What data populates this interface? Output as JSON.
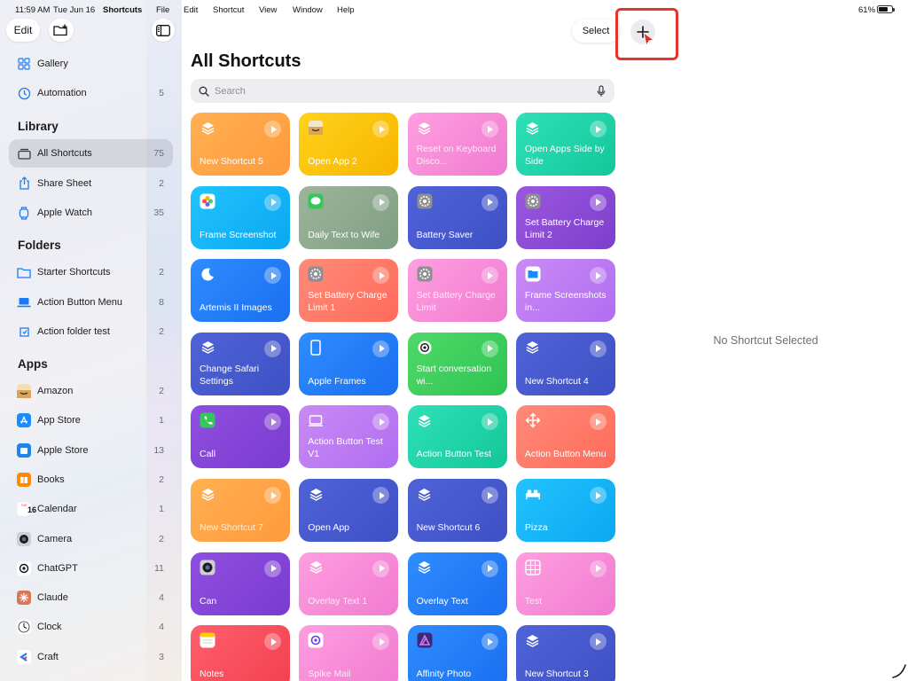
{
  "menubar": {
    "time": "11:59 AM",
    "date": "Tue Jun 16",
    "app_name": "Shortcuts",
    "menus": [
      "File",
      "Edit",
      "Shortcut",
      "View",
      "Window",
      "Help"
    ],
    "battery_text": "61%",
    "battery_level": 0.61
  },
  "sidebar": {
    "edit_label": "Edit",
    "top_items": [
      {
        "label": "Gallery",
        "count": "",
        "icon": "grid-icon"
      },
      {
        "label": "Automation",
        "count": "5",
        "icon": "clock-check-icon"
      }
    ],
    "library_heading": "Library",
    "library_items": [
      {
        "label": "All Shortcuts",
        "count": "75",
        "icon": "stack-icon",
        "selected": true
      },
      {
        "label": "Share Sheet",
        "count": "2",
        "icon": "share-icon"
      },
      {
        "label": "Apple Watch",
        "count": "35",
        "icon": "watch-icon"
      }
    ],
    "folders_heading": "Folders",
    "folder_items": [
      {
        "label": "Starter Shortcuts",
        "count": "2",
        "icon": "folder-icon"
      },
      {
        "label": "Action Button Menu",
        "count": "8",
        "icon": "laptop-icon"
      },
      {
        "label": "Action folder test",
        "count": "2",
        "icon": "action-icon"
      }
    ],
    "apps_heading": "Apps",
    "app_items": [
      {
        "label": "Amazon",
        "count": "2",
        "color": "#f3a847"
      },
      {
        "label": "App Store",
        "count": "1",
        "color": "#1a8cff"
      },
      {
        "label": "Apple Store",
        "count": "13",
        "color": "#1f84e8"
      },
      {
        "label": "Books",
        "count": "2",
        "color": "#ff8a00"
      },
      {
        "label": "Calendar",
        "count": "1",
        "color": "#ffffff"
      },
      {
        "label": "Camera",
        "count": "2",
        "color": "#3a3a3c"
      },
      {
        "label": "ChatGPT",
        "count": "11",
        "color": "#ffffff"
      },
      {
        "label": "Claude",
        "count": "4",
        "color": "#d97757"
      },
      {
        "label": "Clock",
        "count": "4",
        "color": "#ffffff"
      },
      {
        "label": "Craft",
        "count": "3",
        "color": "#ffffff"
      }
    ],
    "calendar_day": "16"
  },
  "main": {
    "title": "All Shortcuts",
    "select_label": "Select",
    "search_placeholder": "Search",
    "tiles": [
      {
        "name": "New Shortcut 5",
        "bg": "linear-gradient(135deg,#ffb052,#ff9a3c)",
        "icon": "layers"
      },
      {
        "name": "Open App 2",
        "bg": "linear-gradient(135deg,#ffd21a,#f7b500)",
        "icon": "amazon"
      },
      {
        "name": "Reset on Keyboard Disco...",
        "bg": "linear-gradient(135deg,#ff9ee0,#f07bd0)",
        "icon": "layers",
        "faded": true
      },
      {
        "name": "Open Apps Side by Side",
        "bg": "linear-gradient(135deg,#2fe0b8,#13c79a)",
        "icon": "layers"
      },
      {
        "name": "Frame Screenshot",
        "bg": "linear-gradient(135deg,#22c3ff,#0aa8f0)",
        "icon": "photos"
      },
      {
        "name": "Daily Text to Wife",
        "bg": "linear-gradient(135deg,#9db59c,#7f9e82)",
        "icon": "messages"
      },
      {
        "name": "Battery Saver",
        "bg": "linear-gradient(135deg,#4f63d8,#3e50c4)",
        "icon": "settings"
      },
      {
        "name": "Set Battery Charge Limit 2",
        "bg": "linear-gradient(135deg,#9b57e0,#7d3fcc)",
        "icon": "settings"
      },
      {
        "name": "Artemis II Images",
        "bg": "linear-gradient(135deg,#2f8cff,#1a6ff0)",
        "icon": "moon"
      },
      {
        "name": "Set Battery Charge Limit 1",
        "bg": "linear-gradient(135deg,#ff8a78,#ff6b5a)",
        "icon": "settings"
      },
      {
        "name": "Set Battery Charge Limit",
        "bg": "linear-gradient(135deg,#ff9ee0,#f07bd0)",
        "icon": "settings",
        "faded": true
      },
      {
        "name": "Frame Screenshots in...",
        "bg": "linear-gradient(135deg,#c98af5,#b06ef0)",
        "icon": "files"
      },
      {
        "name": "Change Safari Settings",
        "bg": "linear-gradient(135deg,#4f63d8,#3e50c4)",
        "icon": "layers"
      },
      {
        "name": "Apple Frames",
        "bg": "linear-gradient(135deg,#2f8cff,#1a6ff0)",
        "icon": "phone-outline"
      },
      {
        "name": "Start conversation wi...",
        "bg": "linear-gradient(135deg,#4fd968,#2fc452)",
        "icon": "chatgpt"
      },
      {
        "name": "New Shortcut 4",
        "bg": "linear-gradient(135deg,#4f63d8,#3e50c4)",
        "icon": "layers"
      },
      {
        "name": "Call",
        "bg": "linear-gradient(135deg,#8f4fe0,#7a3bd0)",
        "icon": "phone"
      },
      {
        "name": "Action Button Test V1",
        "bg": "linear-gradient(135deg,#c98af5,#b06ef0)",
        "icon": "laptop"
      },
      {
        "name": "Action Button Test",
        "bg": "linear-gradient(135deg,#2fe0b8,#13c79a)",
        "icon": "layers"
      },
      {
        "name": "Action Button Menu",
        "bg": "linear-gradient(135deg,#ff8a78,#ff6b5a)",
        "icon": "move"
      },
      {
        "name": "New Shortcut 7",
        "bg": "linear-gradient(135deg,#ffb052,#ff9a3c)",
        "icon": "layers",
        "faded": true
      },
      {
        "name": "Open App",
        "bg": "linear-gradient(135deg,#4f63d8,#3e50c4)",
        "icon": "layers"
      },
      {
        "name": "New Shortcut 6",
        "bg": "linear-gradient(135deg,#4f63d8,#3e50c4)",
        "icon": "layers"
      },
      {
        "name": "Pizza",
        "bg": "linear-gradient(135deg,#22c3ff,#0aa8f0)",
        "icon": "bed"
      },
      {
        "name": "Can",
        "bg": "linear-gradient(135deg,#8f4fe0,#7a3bd0)",
        "icon": "camera"
      },
      {
        "name": "Overlay Text 1",
        "bg": "linear-gradient(135deg,#ff9ee0,#f07bd0)",
        "icon": "layers",
        "faded": true
      },
      {
        "name": "Overlay Text",
        "bg": "linear-gradient(135deg,#2f8cff,#1a6ff0)",
        "icon": "layers"
      },
      {
        "name": "Test",
        "bg": "linear-gradient(135deg,#ff9ee0,#f07bd0)",
        "icon": "grid-dots",
        "faded": true
      },
      {
        "name": "Notes",
        "bg": "linear-gradient(135deg,#ff5f6d,#f2404f)",
        "icon": "notes"
      },
      {
        "name": "Spike Mail",
        "bg": "linear-gradient(135deg,#ff9ee0,#f07bd0)",
        "icon": "spike",
        "faded": true
      },
      {
        "name": "Affinity Photo",
        "bg": "linear-gradient(135deg,#2f8cff,#1a6ff0)",
        "icon": "affinity"
      },
      {
        "name": "New Shortcut 3",
        "bg": "linear-gradient(135deg,#4f63d8,#3e50c4)",
        "icon": "layers"
      }
    ]
  },
  "detail": {
    "empty_text": "No Shortcut Selected"
  },
  "colors": {
    "highlight": "#e8322c",
    "cursor": "#d4322c"
  }
}
